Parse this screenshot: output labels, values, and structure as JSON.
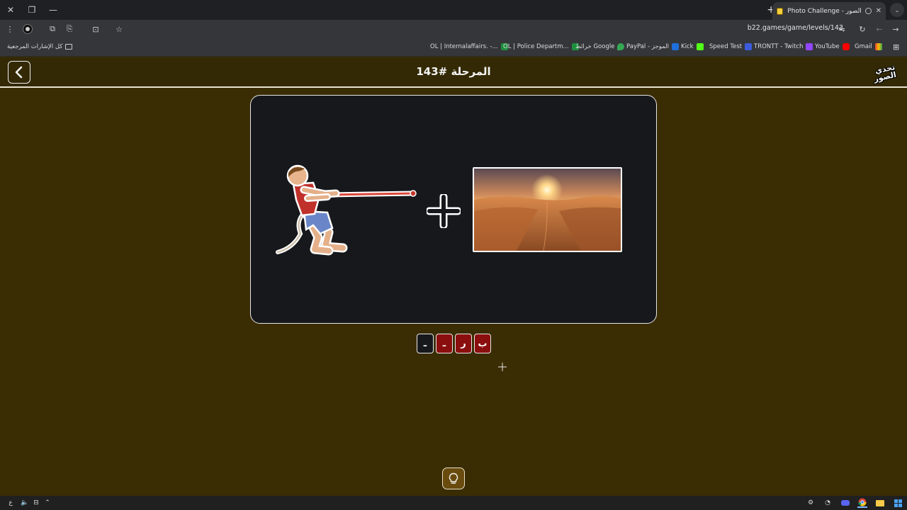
{
  "browser": {
    "tab_title": "Photo Challenge - تحدي الصور",
    "url": "b22.games/game/levels/143",
    "bookmarks": [
      "OL | Internalaffairs. -...",
      "OL | Police Departm...",
      "خرائط Google",
      "PayPal - الموجز",
      "Kick",
      "Speed Test",
      "TRONTT - Twitch",
      "YouTube",
      "Gmail"
    ],
    "all_bookmarks": "كل الإشارات المرجعية"
  },
  "game": {
    "level_title": "المرحلة #143",
    "logo_line1": "تحدي",
    "logo_line2": "الصور",
    "slots": [
      {
        "letter": "ب",
        "state": "filled"
      },
      {
        "letter": "ر",
        "state": "filled"
      },
      {
        "letter": "ـ",
        "state": "filled"
      },
      {
        "letter": "ـ",
        "state": "empty"
      }
    ],
    "images": [
      "person-pulling-rope",
      "desert-sunset"
    ]
  },
  "taskbar": {
    "language": "ع"
  },
  "colors": {
    "page_bg": "#3a2d04",
    "card_bg": "#16181b",
    "slot_filled": "#8b0e0e",
    "hint_bg": "#6a4b0e"
  }
}
